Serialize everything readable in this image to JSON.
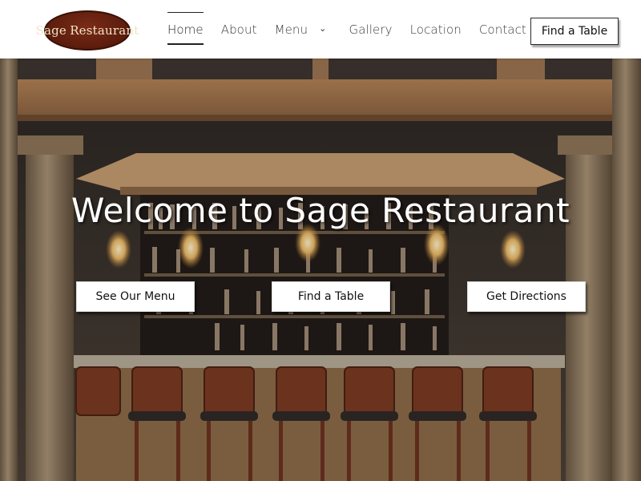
{
  "brand": {
    "logo_text_1": "Sage",
    "logo_text_2": "Restaurant"
  },
  "nav": {
    "items": [
      {
        "label": "Home",
        "active": true
      },
      {
        "label": "About"
      },
      {
        "label": "Menu",
        "has_dropdown": true
      },
      {
        "label": "Gallery"
      },
      {
        "label": "Location"
      },
      {
        "label": "Contact"
      }
    ]
  },
  "header_cta": "Find a Table",
  "hero": {
    "title": "Welcome to Sage Restaurant",
    "buttons": [
      "See Our Menu",
      "Find a Table",
      "Get Directions"
    ]
  },
  "icons": {
    "dropdown": "chevron-down-icon"
  },
  "colors": {
    "logo_bg": "#5d1d0d",
    "logo_text": "#f1e4c7",
    "accent_text": "#222222"
  }
}
